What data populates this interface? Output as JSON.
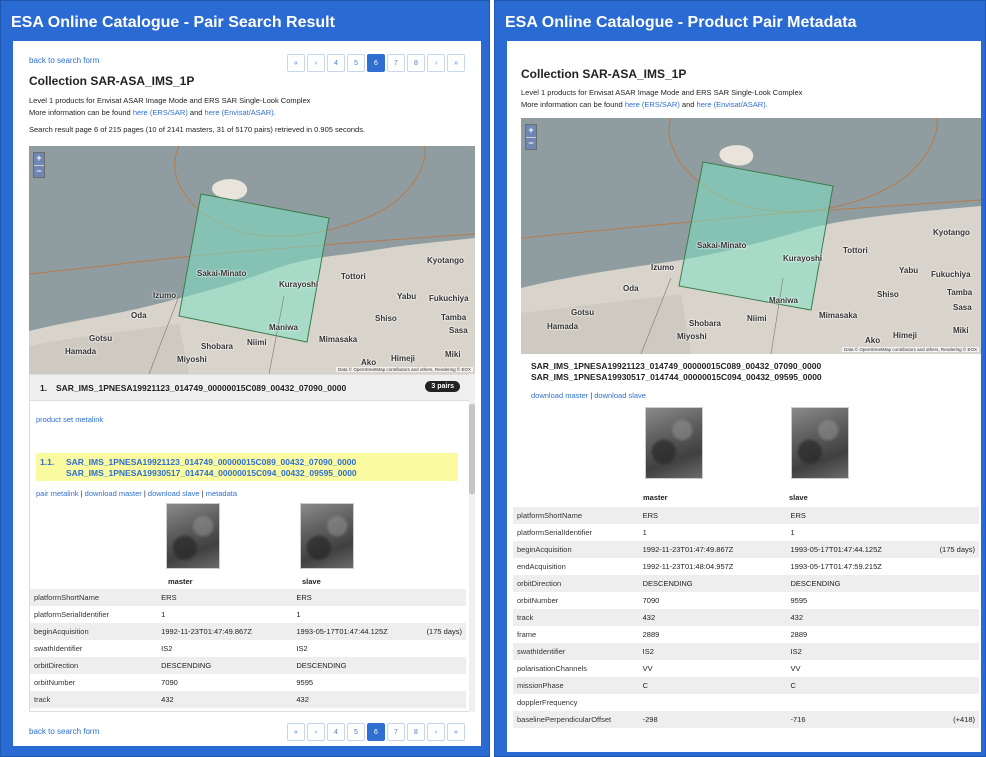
{
  "left": {
    "title": "ESA Online Catalogue - Pair Search Result",
    "back_link": "back to search form",
    "collection_title": "Collection SAR-ASA_IMS_1P",
    "desc1": "Level 1 products for Envisat ASAR Image Mode and ERS SAR Single-Look Complex",
    "desc2_pre": "More information can be found ",
    "desc2_link1": "here (ERS/SAR)",
    "desc2_and": " and ",
    "desc2_link2": "here (Envisat/ASAR).",
    "search_status": "Search result page 6 of 215 pages (10 of 2141 masters, 31 of 5170 pairs) retrieved in 0.905 seconds.",
    "pager": [
      "«",
      "‹",
      "4",
      "5",
      "6",
      "7",
      "8",
      "›",
      "»"
    ],
    "pager_active": "6",
    "result_number": "1.",
    "result_title": "SAR_IMS_1PNESA19921123_014749_00000015C089_00432_07090_0000",
    "pairs_badge": "3 pairs",
    "product_set_metalink": "product set metalink",
    "pair_number": "1.1.",
    "pair_master": "SAR_IMS_1PNESA19921123_014749_00000015C089_00432_07090_0000",
    "pair_slave": "SAR_IMS_1PNESA19930517_014744_00000015C094_00432_09595_0000",
    "pair_metalink": "pair metalink",
    "download_master": "download master",
    "download_slave": "download slave",
    "metadata": "metadata",
    "sep": " | ",
    "col_master": "master",
    "col_slave": "slave",
    "rows": [
      {
        "k": "platformShortName",
        "m": "ERS",
        "s": "ERS",
        "x": ""
      },
      {
        "k": "platformSerialIdentifier",
        "m": "1",
        "s": "1",
        "x": ""
      },
      {
        "k": "beginAcquisition",
        "m": "1992-11-23T01:47:49.867Z",
        "s": "1993-05-17T01:47:44.125Z",
        "x": "(175 days)"
      },
      {
        "k": "swathIdentifier",
        "m": "IS2",
        "s": "IS2",
        "x": ""
      },
      {
        "k": "orbitDirection",
        "m": "DESCENDING",
        "s": "DESCENDING",
        "x": ""
      },
      {
        "k": "orbitNumber",
        "m": "7090",
        "s": "9595",
        "x": ""
      },
      {
        "k": "track",
        "m": "432",
        "s": "432",
        "x": ""
      }
    ]
  },
  "right": {
    "title": "ESA Online Catalogue - Product Pair Metadata",
    "collection_title": "Collection SAR-ASA_IMS_1P",
    "desc1": "Level 1 products for Envisat ASAR Image Mode and ERS SAR Single-Look Complex",
    "desc2_pre": "More information can be found ",
    "desc2_link1": "here (ERS/SAR)",
    "desc2_and": " and ",
    "desc2_link2": "here (Envisat/ASAR).",
    "pair_master": "SAR_IMS_1PNESA19921123_014749_00000015C089_00432_07090_0000",
    "pair_slave": "SAR_IMS_1PNESA19930517_014744_00000015C094_00432_09595_0000",
    "download_master": "download master",
    "download_slave": "download slave",
    "sep": " | ",
    "col_master": "master",
    "col_slave": "slave",
    "rows": [
      {
        "k": "platformShortName",
        "m": "ERS",
        "s": "ERS",
        "x": ""
      },
      {
        "k": "platformSerialIdentifier",
        "m": "1",
        "s": "1",
        "x": ""
      },
      {
        "k": "beginAcquisition",
        "m": "1992-11-23T01:47:49.867Z",
        "s": "1993-05-17T01:47:44.125Z",
        "x": "(175 days)"
      },
      {
        "k": "endAcquisition",
        "m": "1992-11-23T01:48:04.957Z",
        "s": "1993-05-17T01:47:59.215Z",
        "x": ""
      },
      {
        "k": "orbitDirection",
        "m": "DESCENDING",
        "s": "DESCENDING",
        "x": ""
      },
      {
        "k": "orbitNumber",
        "m": "7090",
        "s": "9595",
        "x": ""
      },
      {
        "k": "track",
        "m": "432",
        "s": "432",
        "x": ""
      },
      {
        "k": "frame",
        "m": "2889",
        "s": "2889",
        "x": ""
      },
      {
        "k": "swathIdentifier",
        "m": "IS2",
        "s": "IS2",
        "x": ""
      },
      {
        "k": "polarisationChannels",
        "m": "VV",
        "s": "VV",
        "x": ""
      },
      {
        "k": "missionPhase",
        "m": "C",
        "s": "C",
        "x": ""
      },
      {
        "k": "dopplerFrequency",
        "m": "",
        "s": "",
        "x": ""
      },
      {
        "k": "baselinePerpendicularOffset",
        "m": "-298",
        "s": "-716",
        "x": "(+418)"
      }
    ]
  },
  "map": {
    "zoom_in": "+",
    "zoom_out": "−",
    "places": [
      "Kyotango",
      "Sakai-Minato",
      "Tottori",
      "Izumo",
      "Kurayoshi",
      "Yabu",
      "Fukuchiya",
      "Oda",
      "Shiso",
      "Tamba",
      "Maniwa",
      "Sasa",
      "Gotsu",
      "Shobara",
      "Niimi",
      "Mimasaka",
      "Hamada",
      "Miyoshi",
      "Ako",
      "Himeji",
      "Miki"
    ],
    "attribution": "Data © OpenStreetMap contributors and others, Rendering © EOX",
    "colors": {
      "sea": "#8e9ca1",
      "land": "#d9d4cc",
      "footprint": "#7fe0c4"
    }
  }
}
